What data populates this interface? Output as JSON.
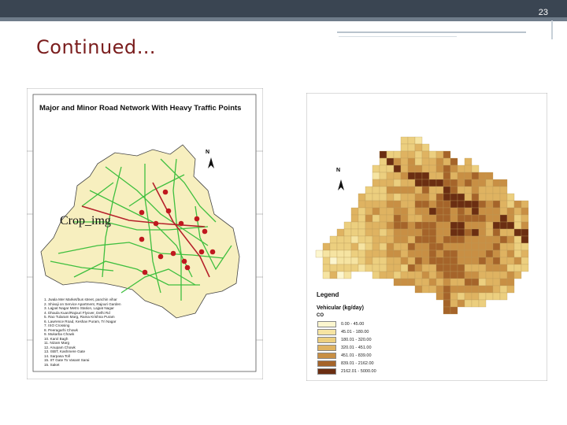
{
  "slide": {
    "number": "23",
    "title": "Continued…"
  },
  "left_map": {
    "title": "Major and Minor Road Network With Heavy Traffic Points",
    "crop_label": "Crop_img",
    "north": "N",
    "points": [
      "1",
      "2",
      "3",
      "4",
      "5",
      "6",
      "7",
      "8",
      "9",
      "10",
      "11",
      "12",
      "13",
      "14",
      "15"
    ],
    "legend": [
      "1. Jwala Mer Market/bus street, panchin vihar",
      "2. Shivaji on Service Apartment, Rajouri Garden",
      "3. Lajpat Nagar Metro Station, Lajpat Nagar",
      "4. Dhaula Kuan/Rajouri Flyover, Delhi Rd",
      "5. Rao Tularam Marg, Rama Krishna Puram",
      "6. Lawrence Road, Keshav Puram, Tri Nagar",
      "7. ISO Crossing",
      "8. Peeragarhi Chowk",
      "9. Mukarba Chowk",
      "10. Karol Bagh",
      "11. Nizam Marg",
      "12. Anupam Chowk",
      "13. ISBT, Kashmere Gate",
      "14. Sarpasa Toll",
      "15. IIT Gate To Vasant Sarai",
      "15. Saket"
    ]
  },
  "right_map": {
    "north": "N",
    "legend_title": "Legend",
    "legend_subtitle": "Vehicular (kg/day)",
    "pollutant": "CO",
    "classes": [
      {
        "range": "0.00 - 45.00",
        "color": "#fcf6cf"
      },
      {
        "range": "45.01 - 180.00",
        "color": "#f6e4a2"
      },
      {
        "range": "180.01 - 320.00",
        "color": "#eccf7f"
      },
      {
        "range": "320.01 - 451.00",
        "color": "#dfb361"
      },
      {
        "range": "451.01 - 839.00",
        "color": "#c88f44"
      },
      {
        "range": "839.01 - 2162.00",
        "color": "#a5642a"
      },
      {
        "range": "2162.01 - 5000.00",
        "color": "#6b2e12"
      }
    ]
  }
}
